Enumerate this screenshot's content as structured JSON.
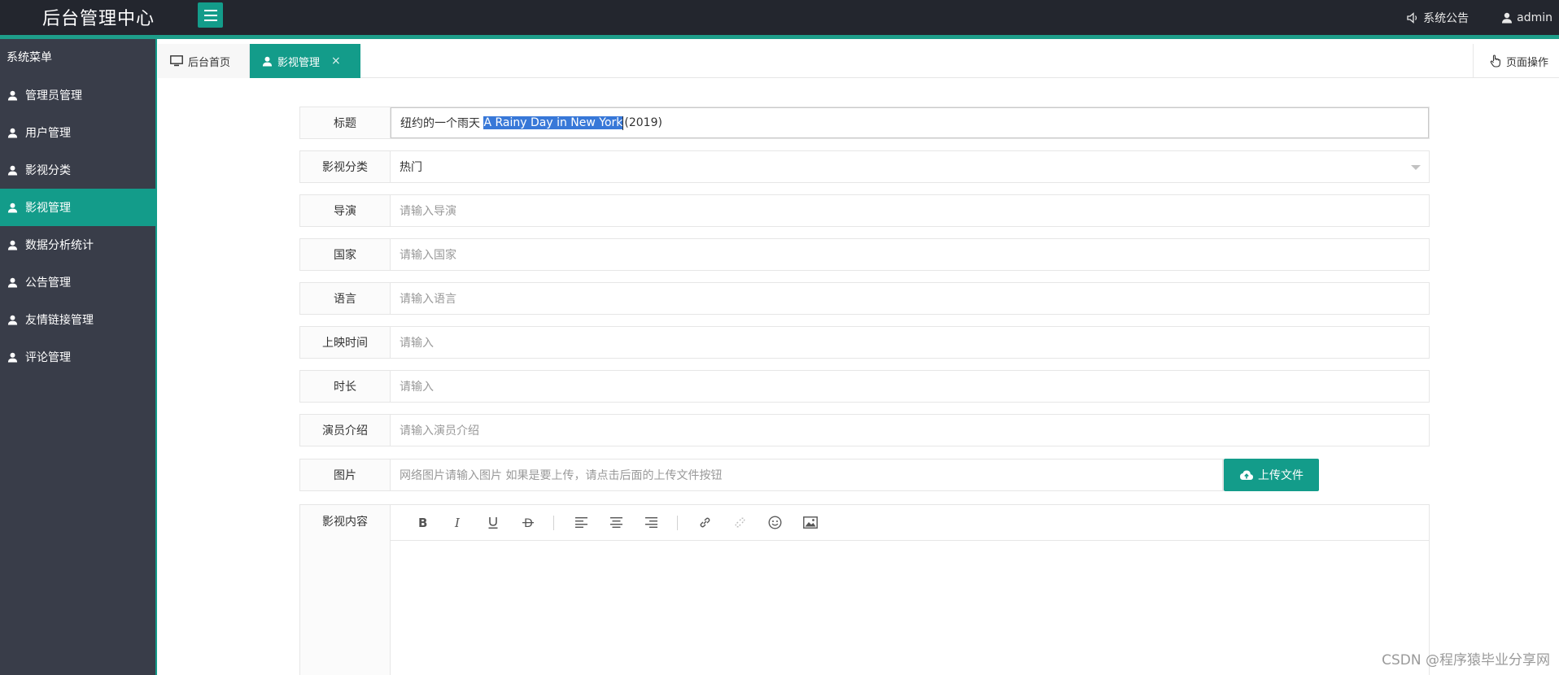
{
  "header": {
    "brand": "后台管理中心",
    "notice_label": "系统公告",
    "user_label": "admin"
  },
  "sidebar": {
    "title": "系统菜单",
    "items": [
      {
        "label": "管理员管理"
      },
      {
        "label": "用户管理"
      },
      {
        "label": "影视分类"
      },
      {
        "label": "影视管理"
      },
      {
        "label": "数据分析统计"
      },
      {
        "label": "公告管理"
      },
      {
        "label": "友情链接管理"
      },
      {
        "label": "评论管理"
      }
    ],
    "active_index": 3
  },
  "tabs": {
    "home_label": "后台首页",
    "current_label": "影视管理",
    "close_symbol": "×",
    "page_ops_label": "页面操作"
  },
  "form": {
    "title": {
      "label": "标题",
      "value_before": "纽约的一个雨天 ",
      "value_selected": "A Rainy Day in New York",
      "value_after": "(2019)"
    },
    "category": {
      "label": "影视分类",
      "value": "热门"
    },
    "director": {
      "label": "导演",
      "placeholder": "请输入导演"
    },
    "country": {
      "label": "国家",
      "placeholder": "请输入国家"
    },
    "language": {
      "label": "语言",
      "placeholder": "请输入语言"
    },
    "release_time": {
      "label": "上映时间",
      "placeholder": "请输入"
    },
    "duration": {
      "label": "时长",
      "placeholder": "请输入"
    },
    "actors": {
      "label": "演员介绍",
      "placeholder": "请输入演员介绍"
    },
    "image": {
      "label": "图片",
      "placeholder": "网络图片请输入图片 如果是要上传，请点击后面的上传文件按钮",
      "upload_label": "上传文件"
    },
    "content": {
      "label": "影视内容"
    }
  },
  "editor_tools": [
    "bold-icon",
    "italic-icon",
    "underline-icon",
    "strikethrough-icon",
    "align-left-icon",
    "align-center-icon",
    "align-right-icon",
    "link-icon",
    "unlink-icon",
    "emoji-icon",
    "image-icon"
  ],
  "colors": {
    "accent": "#139c8a",
    "header_bg": "#23262e",
    "sidebar_bg": "#393d49",
    "selection": "#3878d8"
  },
  "watermark": "CSDN @程序猿毕业分享网"
}
